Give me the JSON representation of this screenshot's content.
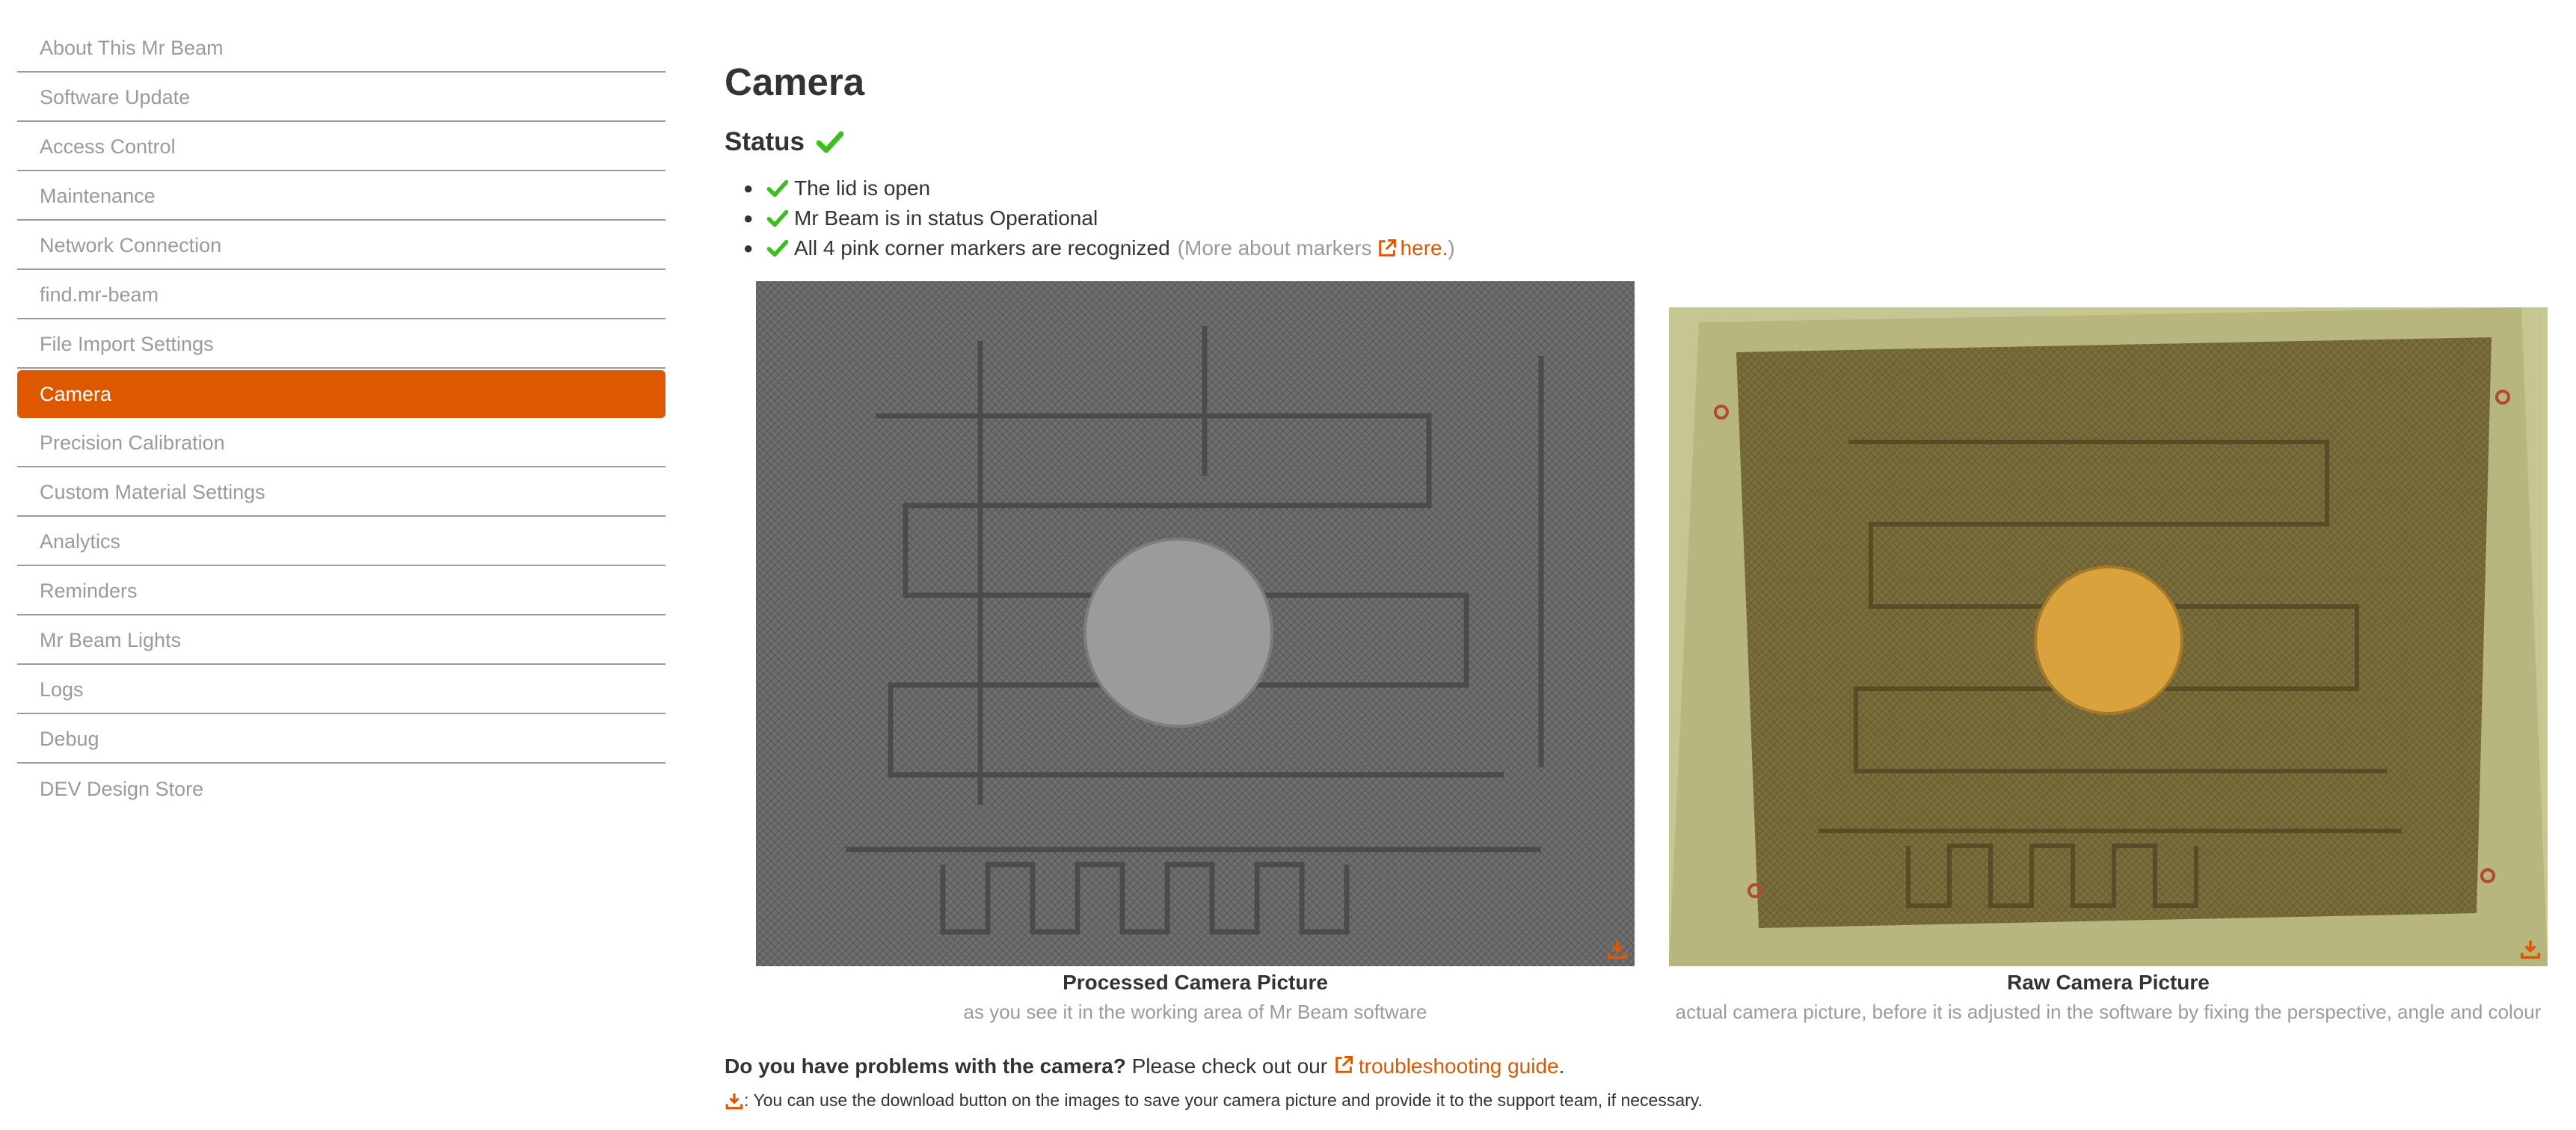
{
  "sidebar": {
    "items": [
      {
        "label": "About This Mr Beam",
        "active": false
      },
      {
        "label": "Software Update",
        "active": false
      },
      {
        "label": "Access Control",
        "active": false
      },
      {
        "label": "Maintenance",
        "active": false
      },
      {
        "label": "Network Connection",
        "active": false
      },
      {
        "label": "find.mr-beam",
        "active": false
      },
      {
        "label": "File Import Settings",
        "active": false
      },
      {
        "label": "Camera",
        "active": true
      },
      {
        "label": "Precision Calibration",
        "active": false
      },
      {
        "label": "Custom Material Settings",
        "active": false
      },
      {
        "label": "Analytics",
        "active": false
      },
      {
        "label": "Reminders",
        "active": false
      },
      {
        "label": "Mr Beam Lights",
        "active": false
      },
      {
        "label": "Logs",
        "active": false
      },
      {
        "label": "Debug",
        "active": false
      },
      {
        "label": "DEV Design Store",
        "active": false
      }
    ]
  },
  "main": {
    "title": "Camera",
    "status_label": "Status",
    "checks": [
      "The lid is open",
      "Mr Beam is in status Operational",
      "All 4 pink corner markers are recognized"
    ],
    "markers_note_prefix": "(More about markers",
    "markers_link": "here.",
    "markers_note_suffix": ")",
    "processed": {
      "title": "Processed Camera Picture",
      "subtitle": "as you see it in the working area of Mr Beam software"
    },
    "raw": {
      "title": "Raw Camera Picture",
      "subtitle": "actual camera picture, before it is adjusted in the software by fixing the perspective, angle and colour"
    },
    "help_question": "Do you have problems with the camera?",
    "help_text": " Please check out our ",
    "help_link": "troubleshooting guide",
    "help_end": ".",
    "download_note": ": You can use the download button on the images to save your camera picture and provide it to the support team, if necessary."
  },
  "colors": {
    "accent": "#dd5800",
    "success": "#3cbf1e",
    "muted": "#9a9a9a"
  },
  "icons": [
    "check-icon",
    "external-link-icon",
    "download-icon"
  ]
}
